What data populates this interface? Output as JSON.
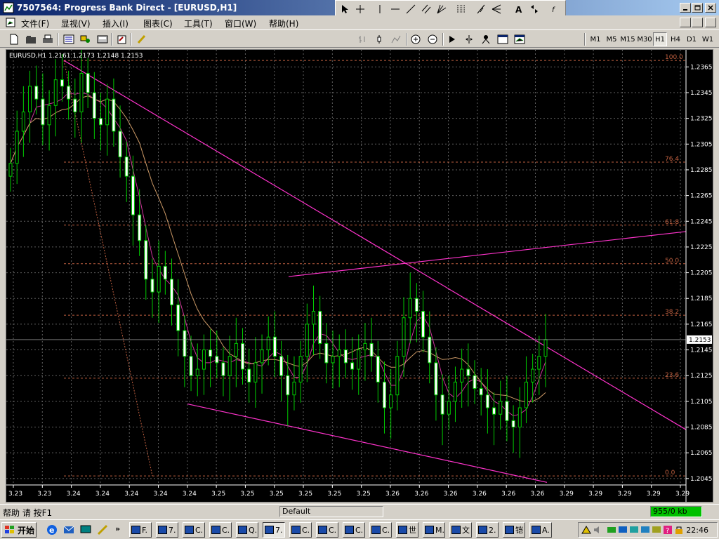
{
  "window": {
    "title": "7507564: Progress Bank Direct - [EURUSD,H1]"
  },
  "menu": [
    {
      "label": "文件(F)"
    },
    {
      "label": "显视(V)"
    },
    {
      "label": "插入(I)"
    },
    {
      "label": "图表(C)"
    },
    {
      "label": "工具(T)"
    },
    {
      "label": "窗口(W)"
    },
    {
      "label": "帮助(H)"
    }
  ],
  "timeframes": [
    {
      "label": "M1"
    },
    {
      "label": "M5"
    },
    {
      "label": "M15"
    },
    {
      "label": "M30"
    },
    {
      "label": "H1",
      "active": true
    },
    {
      "label": "H4"
    },
    {
      "label": "D1"
    },
    {
      "label": "W1"
    }
  ],
  "chart": {
    "header": "EURUSD,H1  1.2161 1.2173 1.2148 1.2153",
    "current_price": "1.2153",
    "y_ticks": [
      "1.2365",
      "1.2345",
      "1.2325",
      "1.2305",
      "1.2285",
      "1.2265",
      "1.2245",
      "1.2225",
      "1.2205",
      "1.2185",
      "1.2165",
      "1.2145",
      "1.2125",
      "1.2105",
      "1.2085",
      "1.2065",
      "1.2045"
    ],
    "x_ticks": [
      "3.23",
      "3.23",
      "3.24",
      "3.24",
      "3.24",
      "3.24",
      "3.24",
      "3.25",
      "3.25",
      "3.25",
      "3.25",
      "3.25",
      "3.25",
      "3.26",
      "3.26",
      "3.26",
      "3.26",
      "3.26",
      "3.26",
      "3.29",
      "3.29",
      "3.29",
      "3.29",
      "3.29"
    ],
    "fib_labels": [
      "100.0",
      "76.4",
      "61.8",
      "50.0",
      "38.2",
      "23.6",
      "0.0"
    ]
  },
  "chart_data": {
    "type": "candlestick",
    "symbol": "EURUSD",
    "timeframe": "H1",
    "ylim": [
      1.204,
      1.2375
    ],
    "last": {
      "open": 1.2161,
      "high": 1.2173,
      "low": 1.2148,
      "close": 1.2153
    },
    "fibonacci": [
      {
        "level": "100.0",
        "price": 1.237
      },
      {
        "level": "76.4",
        "price": 1.2291
      },
      {
        "level": "61.8",
        "price": 1.2242
      },
      {
        "level": "50.0",
        "price": 1.2212
      },
      {
        "level": "38.2",
        "price": 1.2172
      },
      {
        "level": "23.6",
        "price": 1.2123
      },
      {
        "level": "0.0",
        "price": 1.2047
      }
    ],
    "close_path": [
      1.229,
      1.2315,
      1.233,
      1.235,
      1.234,
      1.232,
      1.2335,
      1.2355,
      1.235,
      1.234,
      1.233,
      1.236,
      1.2345,
      1.2325,
      1.232,
      1.234,
      1.2315,
      1.2295,
      1.228,
      1.225,
      1.223,
      1.22,
      1.219,
      1.221,
      1.22,
      1.218,
      1.216,
      1.214,
      1.2125,
      1.213,
      1.2145,
      1.214,
      1.2135,
      1.2125,
      1.214,
      1.215,
      1.213,
      1.212,
      1.2135,
      1.2145,
      1.2155,
      1.214,
      1.2125,
      1.211,
      1.212,
      1.214,
      1.2165,
      1.2175,
      1.215,
      1.2135,
      1.214,
      1.2145,
      1.2135,
      1.213,
      1.2145,
      1.215,
      1.214,
      1.212,
      1.21,
      1.211,
      1.214,
      1.217,
      1.2185,
      1.2175,
      1.2155,
      1.2135,
      1.211,
      1.2095,
      1.2105,
      1.212,
      1.213,
      1.2125,
      1.2115,
      1.211,
      1.21,
      1.2095,
      1.2105,
      1.209,
      1.2085,
      1.21,
      1.212,
      1.213,
      1.214,
      1.2153
    ],
    "footer": {
      "help": "帮助 请 按F1",
      "profile": "Default",
      "traffic": "955/0 kb"
    }
  },
  "taskbar": {
    "start": "开始",
    "buttons": [
      "F.",
      "7.",
      "C.",
      "C.",
      "Q.",
      "7.",
      "C.",
      "C.",
      "C.",
      "C.",
      "世",
      "M.",
      "文",
      "2.",
      "铠",
      "A."
    ],
    "clock": "22:46"
  },
  "colors": {
    "accent": "#0a246a",
    "candle": "#00cc00",
    "fib": "#c06040",
    "trend": "#ff33cc",
    "ma_fast": "#cc3399",
    "ma_slow": "#cc9966"
  }
}
